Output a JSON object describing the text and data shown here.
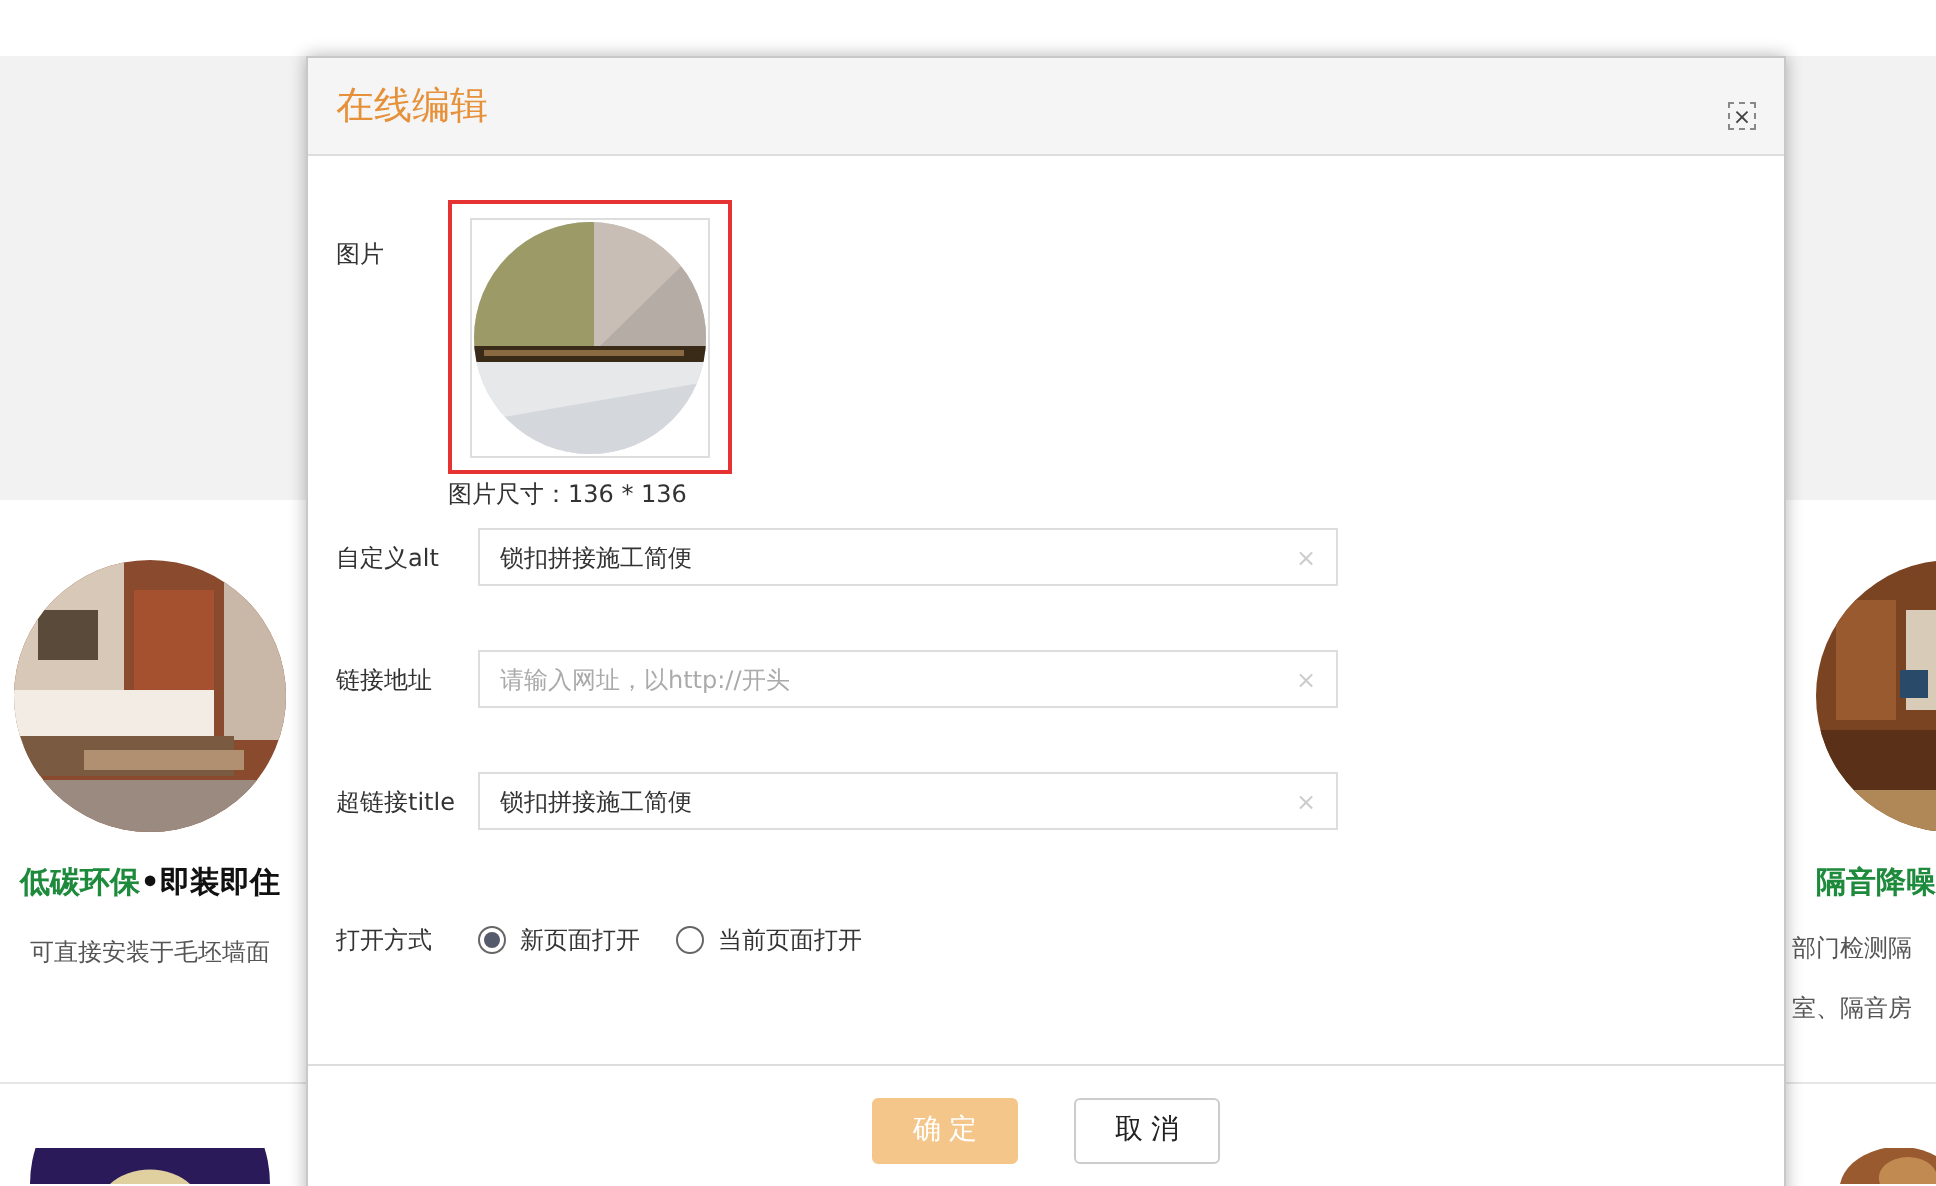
{
  "page": {
    "left_card": {
      "title_highlight": "低碳环保",
      "title_rest": "•即装即住",
      "description": "可直接安装于毛坯墙面"
    },
    "right_card": {
      "title": "隔音降噪",
      "description_lines": [
        "部门检测隔",
        "室、隔音房"
      ]
    }
  },
  "dialog": {
    "title": "在线编辑",
    "close": "×",
    "image_field": {
      "label": "图片",
      "size_caption": "图片尺寸：136 * 136"
    },
    "fields": [
      {
        "label": "自定义alt",
        "value": "锁扣拼接施工简便",
        "clear": "×"
      },
      {
        "label": "链接地址",
        "placeholder": "请输入网址，以http://开头",
        "clear": "×"
      },
      {
        "label": "超链接title",
        "value": "锁扣拼接施工简便",
        "clear": "×"
      }
    ],
    "open_mode": {
      "label": "打开方式",
      "options": [
        {
          "label": "新页面打开",
          "selected": true
        },
        {
          "label": "当前页面打开",
          "selected": false
        }
      ]
    },
    "buttons": [
      {
        "label": "确 定",
        "kind": "primary"
      },
      {
        "label": "取 消",
        "kind": "secondary"
      }
    ]
  }
}
